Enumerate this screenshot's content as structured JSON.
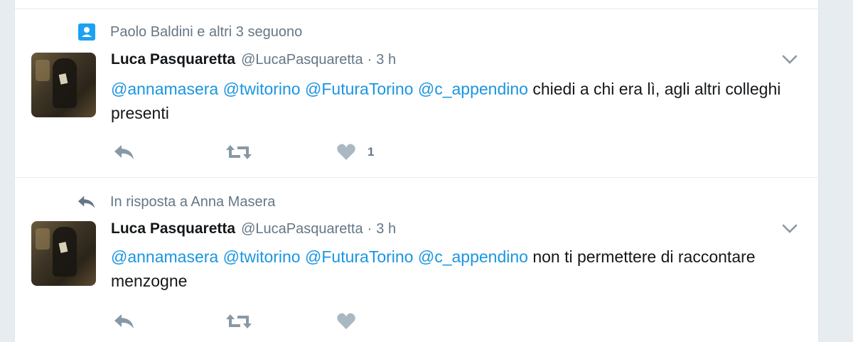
{
  "colors": {
    "link": "#1b95e0",
    "muted": "#657786",
    "text": "#14171a",
    "context_icon_bg": "#1da1f2"
  },
  "tweets": [
    {
      "context": {
        "icon": "person-badge-icon",
        "text": "Paolo Baldini e altri 3 seguono"
      },
      "fullname": "Luca Pasquaretta",
      "username": "@LucaPasquaretta",
      "separator": "·",
      "time": "3 h",
      "mentions": [
        "@annamasera",
        "@twitorino",
        "@FuturaTorino",
        "@c_appendino"
      ],
      "body": "chiedi a chi era lì, agli altri colleghi presenti",
      "actions": {
        "reply_icon": "reply-icon",
        "retweet_icon": "retweet-icon",
        "like_icon": "heart-icon",
        "like_count": "1"
      }
    },
    {
      "context": {
        "icon": "reply-icon",
        "text": "In risposta a Anna Masera"
      },
      "fullname": "Luca Pasquaretta",
      "username": "@LucaPasquaretta",
      "separator": "·",
      "time": "3 h",
      "mentions": [
        "@annamasera",
        "@twitorino",
        "@FuturaTorino",
        "@c_appendino"
      ],
      "body": "non ti permettere di raccontare menzogne",
      "actions": {
        "reply_icon": "reply-icon",
        "retweet_icon": "retweet-icon",
        "like_icon": "heart-icon",
        "like_count": ""
      }
    }
  ]
}
